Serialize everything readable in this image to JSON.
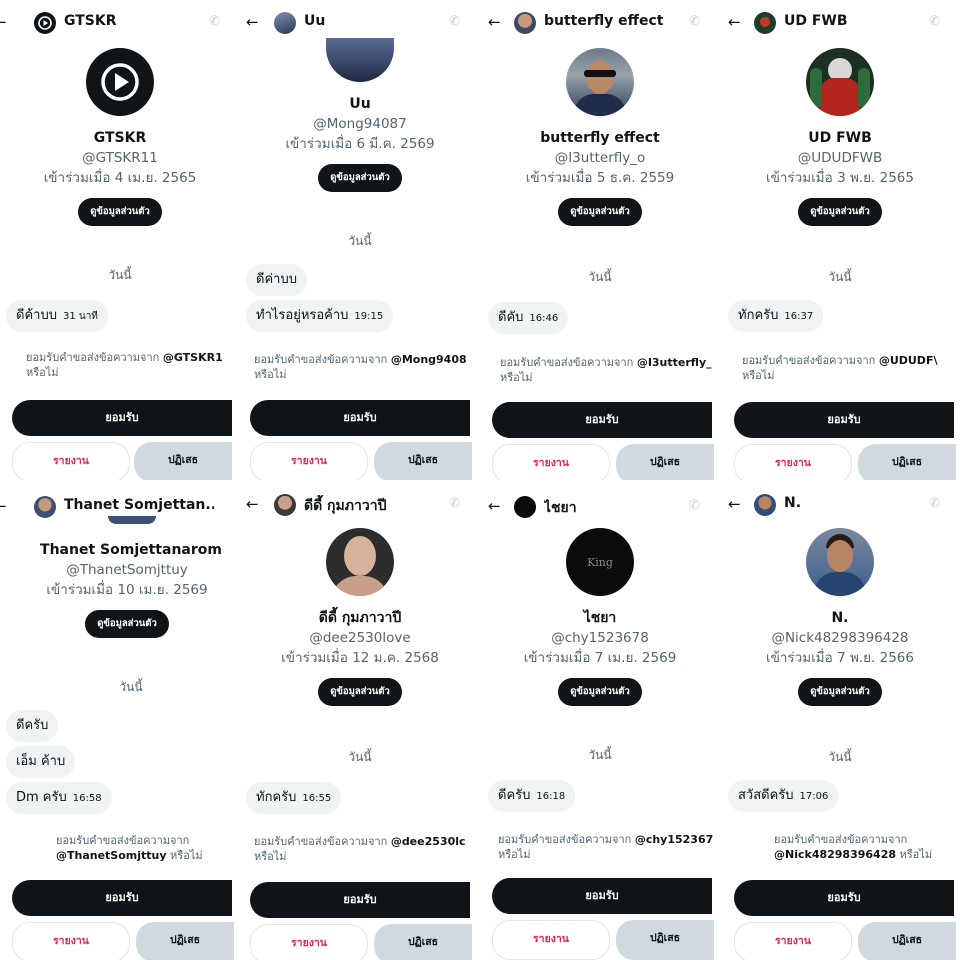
{
  "common": {
    "back_icon": "←",
    "phone_icon": "✆",
    "profile_button": "ดูข้อมูลส่วนตัว",
    "today": "วันนี้",
    "request_prefix": "ยอมรับคำขอส่งข้อความจาก",
    "request_suffix": "หรือไม่",
    "accept": "ยอมรับ",
    "report": "รายงาน",
    "reject": "ปฏิเสธ"
  },
  "panels": [
    {
      "top_name": "GTSKR",
      "name": "GTSKR",
      "handle": "@GTSKR11",
      "joined": "เข้าร่วมเมื่อ 4 เม.ย. 2565",
      "request_handle": "@GTSKR1",
      "messages": [
        {
          "text": "ดีค้าบบ",
          "time": "31 นาที"
        }
      ]
    },
    {
      "top_name": "Uu",
      "name": "Uu",
      "handle": "@Mong94087",
      "joined": "เข้าร่วมเมื่อ 6 มี.ค. 2569",
      "request_handle": "@Mong9408",
      "messages": [
        {
          "text": "ดีค่าบบ",
          "time": ""
        },
        {
          "text": "ทำไรอยู่หรอค้าบ",
          "time": "19:15"
        }
      ]
    },
    {
      "top_name": "butterfly effect",
      "name": "butterfly effect",
      "handle": "@I3utterfly_o",
      "joined": "เข้าร่วมเมื่อ 5 ธ.ค. 2559",
      "request_handle": "@I3utterfly_",
      "messages": [
        {
          "text": "ดีคับ",
          "time": "16:46"
        }
      ]
    },
    {
      "top_name": "UD FWB",
      "name": "UD FWB",
      "handle": "@UDUDFWB",
      "joined": "เข้าร่วมเมื่อ 3 พ.ย. 2565",
      "request_handle": "@UDUDF\\",
      "messages": [
        {
          "text": "ทักครับ",
          "time": "16:37"
        }
      ]
    },
    {
      "top_name": "Thanet Somjettan...",
      "name": "Thanet Somjettanarom",
      "handle": "@ThanetSomjttuy",
      "joined": "เข้าร่วมเมื่อ 10 เม.ย. 2569",
      "request_handle": "@ThanetSomjttuy",
      "messages": [
        {
          "text": "ดีครับ",
          "time": ""
        },
        {
          "text": "เอ็ม ค้าบ",
          "time": ""
        },
        {
          "text": "Dm ครับ",
          "time": "16:58"
        }
      ]
    },
    {
      "top_name": "ดีดี้ กุมภาวาปี",
      "name": "ดีดี้ กุมภาวาปี",
      "handle": "@dee2530love",
      "joined": "เข้าร่วมเมื่อ 12 ม.ค. 2568",
      "request_handle": "@dee2530lc",
      "messages": [
        {
          "text": "ทักครับ",
          "time": "16:55"
        }
      ]
    },
    {
      "top_name": "ไชยา",
      "name": "ไชยา",
      "handle": "@chy1523678",
      "joined": "เข้าร่วมเมื่อ 7 เม.ย. 2569",
      "request_handle": "@chy152367",
      "messages": [
        {
          "text": "ดีครับ",
          "time": "16:18"
        }
      ]
    },
    {
      "top_name": "N.",
      "name": "N.",
      "handle": "@Nick48298396428",
      "joined": "เข้าร่วมเมื่อ 7 พ.ย. 2566",
      "request_handle": "@Nick48298396428",
      "messages": [
        {
          "text": "สวัสดีครับ",
          "time": "17:06"
        }
      ]
    }
  ],
  "avatars": [
    "play-logo-avatar",
    "photo-avatar",
    "photo-avatar",
    "photo-avatar",
    "photo-avatar",
    "photo-avatar",
    "king-logo-avatar",
    "photo-avatar"
  ],
  "colors": {
    "button_dark": "#0f1419",
    "report_red": "#e0245e",
    "reject_gray": "#cfd9de",
    "bubble": "#eff3f4",
    "muted": "#536471"
  }
}
